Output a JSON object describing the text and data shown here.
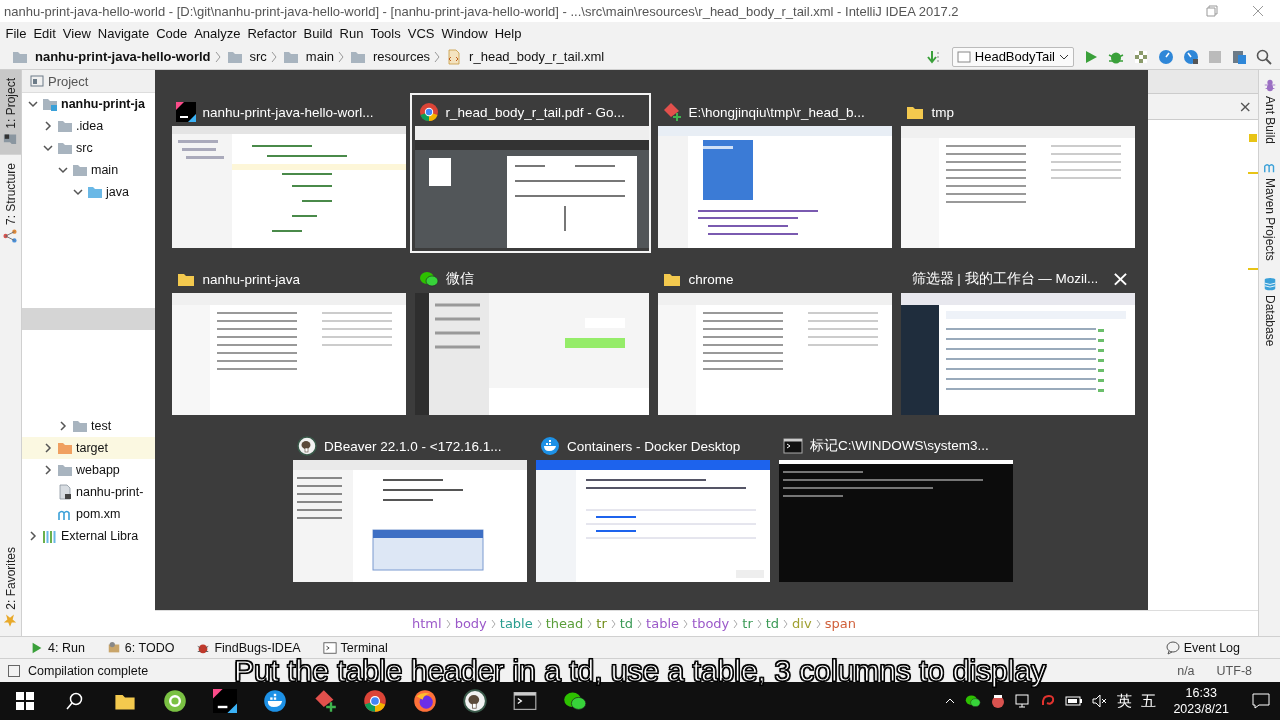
{
  "window": {
    "title": "nanhu-print-java-hello-world - [D:\\git\\nanhu-print-java-hello-world] - [nanhu-print-java-hello-world] - ...\\src\\main\\resources\\r_head_body_r_tail.xml - IntelliJ IDEA 2017.2"
  },
  "menu": [
    "File",
    "Edit",
    "View",
    "Navigate",
    "Code",
    "Analyze",
    "Refactor",
    "Build",
    "Run",
    "Tools",
    "VCS",
    "Window",
    "Help"
  ],
  "navigation": {
    "breadcrumb": [
      {
        "label": "nanhu-print-java-hello-world",
        "kind": "module"
      },
      {
        "label": "src",
        "kind": "folder"
      },
      {
        "label": "main",
        "kind": "folder"
      },
      {
        "label": "resources",
        "kind": "folder"
      },
      {
        "label": "r_head_body_r_tail.xml",
        "kind": "xml"
      }
    ],
    "run_config": "HeadBodyTail"
  },
  "left_stripe": [
    {
      "label": "1: Project",
      "selected": true,
      "kind": "project"
    },
    {
      "label": "7: Structure",
      "selected": false,
      "kind": "structure"
    },
    {
      "label": "2: Favorites",
      "selected": false,
      "kind": "favorites"
    }
  ],
  "project_panel": {
    "title": "Project",
    "tree": [
      {
        "label": "nanhu-print-ja",
        "kind": "module",
        "expanded": true,
        "children": [
          {
            "label": ".idea",
            "kind": "folder",
            "expanded": false
          },
          {
            "label": "src",
            "kind": "folder",
            "expanded": true,
            "children": [
              {
                "label": "main",
                "kind": "folder",
                "expanded": true,
                "children": [
                  {
                    "label": "java",
                    "kind": "source",
                    "expanded": true
                  }
                ]
              },
              {
                "label": "test",
                "kind": "folder",
                "expanded": false
              }
            ]
          },
          {
            "label": "target",
            "kind": "excluded",
            "expanded": false
          },
          {
            "label": "webapp",
            "kind": "folder",
            "expanded": false
          },
          {
            "label": "nanhu-print-",
            "kind": "file"
          },
          {
            "label": "pom.xm",
            "kind": "maven"
          }
        ]
      },
      {
        "label": "External Libra",
        "kind": "libraries",
        "expanded": false
      }
    ]
  },
  "switcher": {
    "rows": [
      [
        {
          "title": "nanhu-print-java-hello-worl...",
          "kind": "ide",
          "selected": false
        },
        {
          "title": "r_head_body_r_tail.pdf - Go...",
          "kind": "browser",
          "selected": true
        },
        {
          "title": "E:\\hongjinqiu\\tmp\\r_head_b...",
          "kind": "editor",
          "selected": false
        },
        {
          "title": "tmp",
          "kind": "folder",
          "selected": false
        }
      ],
      [
        {
          "title": "nanhu-print-java",
          "kind": "folder",
          "selected": false
        },
        {
          "title": "微信",
          "kind": "chat",
          "selected": false
        },
        {
          "title": "chrome",
          "kind": "folder",
          "selected": false
        },
        {
          "title": "筛选器 | 我的工作台 — Mozil...",
          "kind": "firefox",
          "selected": false,
          "close": "×"
        }
      ],
      [
        {
          "title": "DBeaver 22.1.0 - <172.16.1...",
          "kind": "dbeaver",
          "selected": false
        },
        {
          "title": "Containers - Docker Desktop",
          "kind": "docker",
          "selected": false
        },
        {
          "title": "标记C:\\WINDOWS\\system3...",
          "kind": "terminal",
          "selected": false
        }
      ]
    ]
  },
  "find_bar": {
    "close": "×"
  },
  "right_stripe": [
    {
      "label": "Ant Build",
      "kind": "ant"
    },
    {
      "label": "Maven Projects",
      "kind": "maven"
    },
    {
      "label": "Database",
      "kind": "database"
    }
  ],
  "editor_breadcrumb": [
    {
      "tag": "html",
      "color": "#9b59c9"
    },
    {
      "tag": "body",
      "color": "#9b59c9"
    },
    {
      "tag": "table",
      "color": "#2a9d8f"
    },
    {
      "tag": "thead",
      "color": "#5a9e3a"
    },
    {
      "tag": "tr",
      "color": "#6e8c14"
    },
    {
      "tag": "td",
      "color": "#3b9a56"
    },
    {
      "tag": "table",
      "color": "#9b59c9"
    },
    {
      "tag": "tbody",
      "color": "#9b59c9"
    },
    {
      "tag": "tr",
      "color": "#3b9a56"
    },
    {
      "tag": "td",
      "color": "#3b9a56"
    },
    {
      "tag": "div",
      "color": "#a0a030"
    },
    {
      "tag": "span",
      "color": "#d0603a"
    }
  ],
  "bottom_tools": [
    {
      "label": "4: Run",
      "kind": "run"
    },
    {
      "label": "6: TODO",
      "kind": "todo"
    },
    {
      "label": "FindBugs-IDEA",
      "kind": "bug"
    },
    {
      "label": "Terminal",
      "kind": "terminal"
    }
  ],
  "event_log": "Event Log",
  "status_bar": {
    "message": "Compilation complete",
    "position": "n/a",
    "encoding": "UTF-8"
  },
  "subtitle": "Put the table header in a td, use a table, 3 columns to display",
  "taskbar": {
    "ime_language": "英",
    "ime_mode": "五",
    "time": "16:33",
    "date": "2023/8/21"
  }
}
